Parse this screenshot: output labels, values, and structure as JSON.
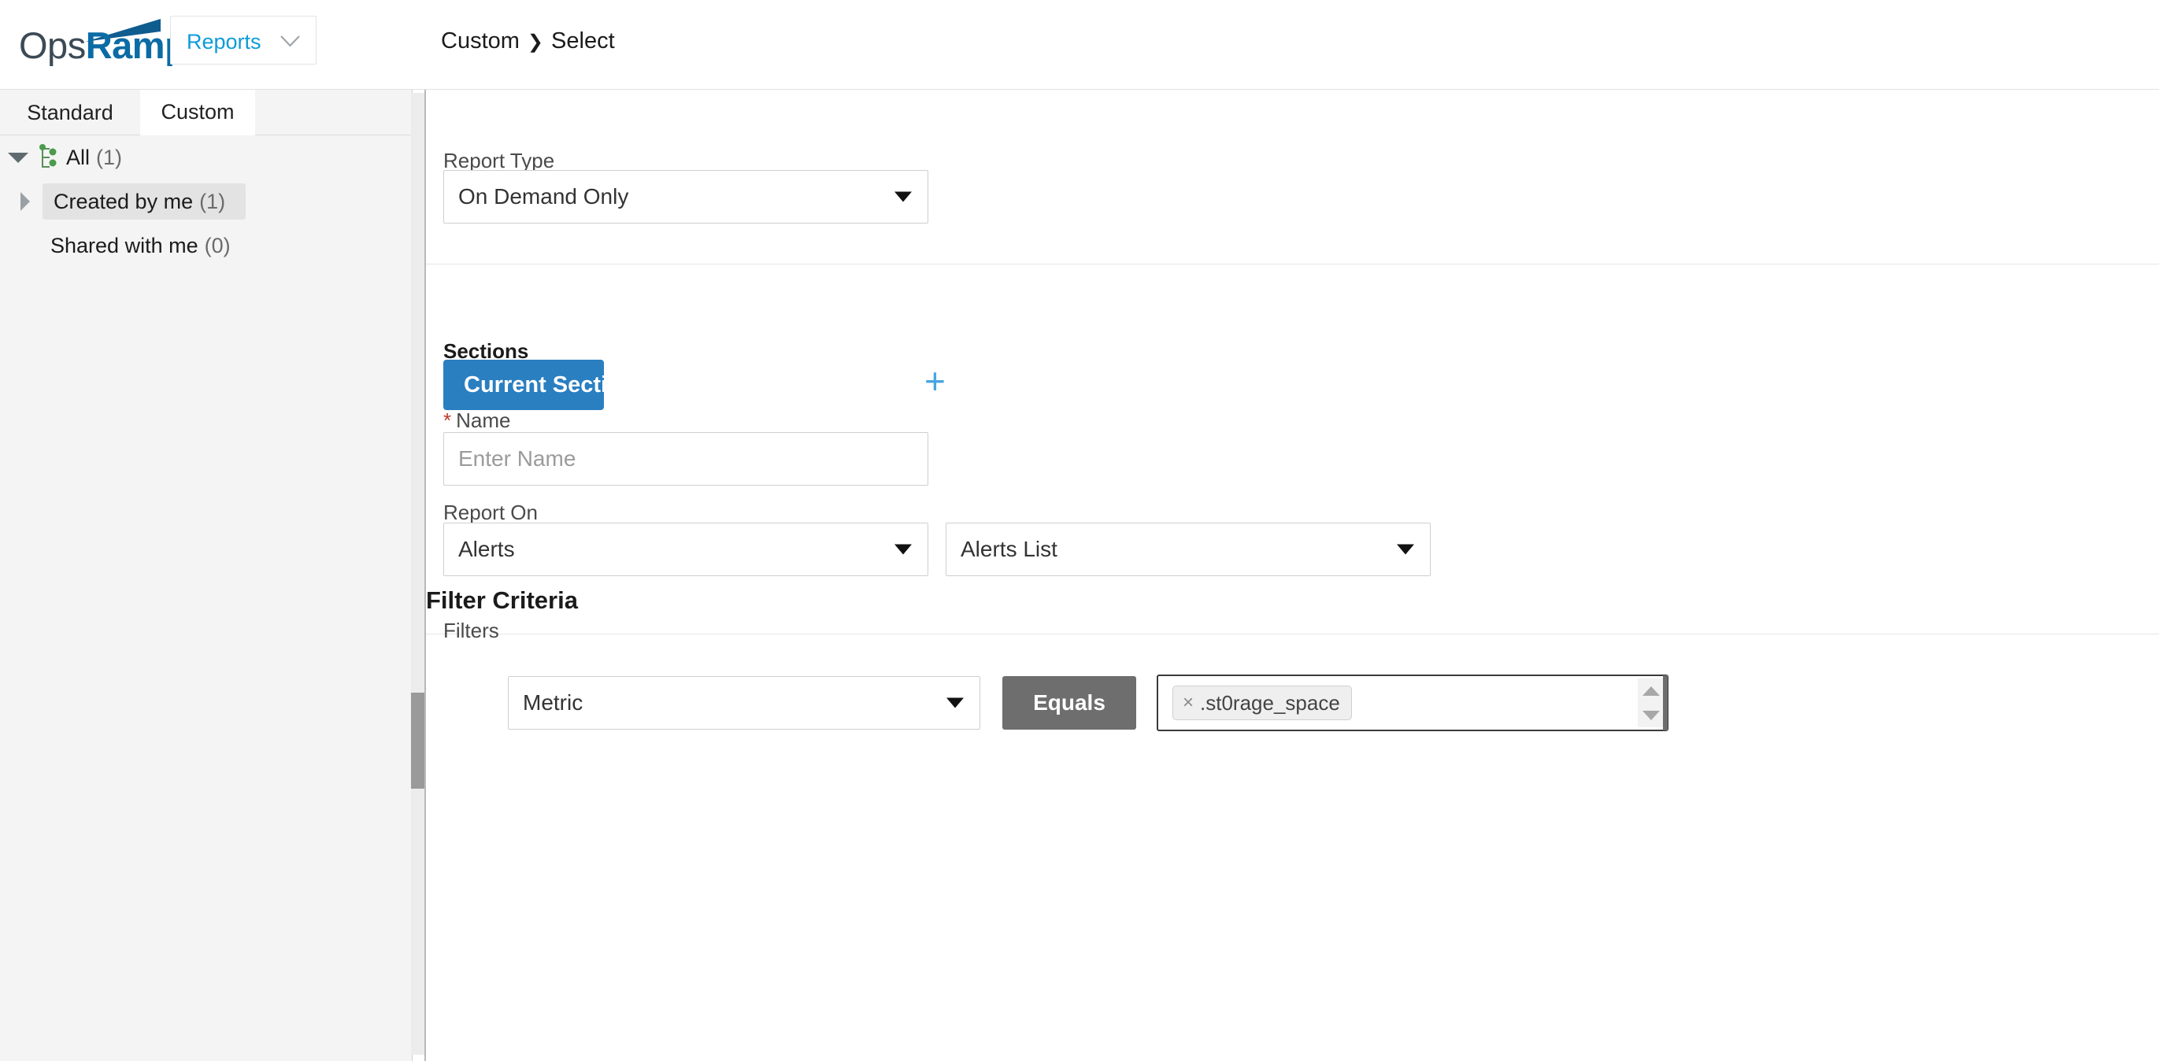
{
  "app": {
    "logo_primary": "Ops",
    "logo_secondary": "Ramp",
    "brand_dark": "#3c4a55",
    "brand_blue": "#0b6ba5",
    "accent_blue": "#0e9bd8"
  },
  "header": {
    "module_label": "Reports",
    "module_icon": "chevron-down-icon",
    "breadcrumb": {
      "parent": "Custom",
      "separator": "❯",
      "current": "Select"
    }
  },
  "sidebar": {
    "tabs": [
      {
        "label": "Standard",
        "active": false
      },
      {
        "label": "Custom",
        "active": true
      }
    ],
    "tree": [
      {
        "label": "All",
        "count": "(1)",
        "icon": "sitemap-icon",
        "expanded": true,
        "selected": false
      },
      {
        "label": "Created by me",
        "count": "(1)",
        "expanded": false,
        "selected": true
      },
      {
        "label": "Shared with me",
        "count": "(0)",
        "expanded": false,
        "selected": false
      }
    ],
    "scrollbar": {
      "name": "sidebar-scrollbar"
    }
  },
  "main": {
    "report_type": {
      "label": "Report Type",
      "value": "On Demand Only"
    },
    "sections": {
      "label": "Sections",
      "chips": [
        {
          "label": "Current Section",
          "remove": "x"
        }
      ],
      "add_label": "+"
    },
    "name": {
      "label": "Name",
      "required_marker": "*",
      "value": "",
      "placeholder": "Enter Name"
    },
    "report_on": {
      "label": "Report On",
      "primary_value": "Alerts",
      "secondary_value": "Alerts List"
    },
    "filter_criteria": {
      "heading": "Filter Criteria",
      "filters_label": "Filters",
      "rows": [
        {
          "attribute": "Metric",
          "operator": "Equals",
          "values": [
            {
              "text": ".st0rage_space",
              "remove": "×"
            }
          ]
        }
      ]
    }
  }
}
